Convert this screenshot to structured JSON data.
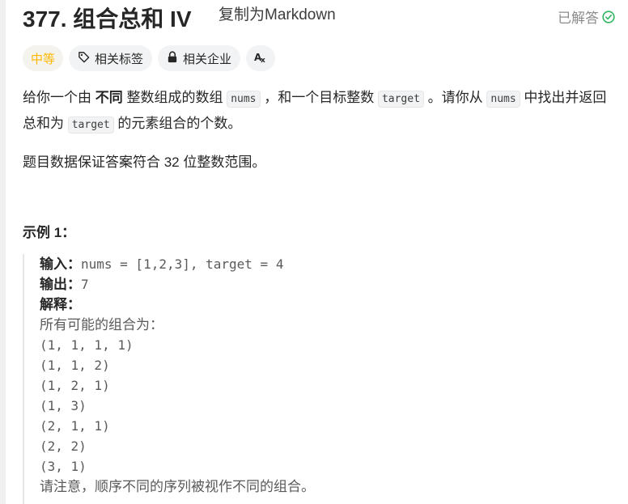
{
  "header": {
    "title": "377. 组合总和 IV",
    "copy_markdown": "复制为Markdown",
    "solved_label": "已解答"
  },
  "tags": {
    "difficulty": "中等",
    "related_tags": "相关标签",
    "related_companies": "相关企业",
    "translate_icon": "Aあ"
  },
  "description": {
    "p1": {
      "t1": "给你一个由 ",
      "bold": "不同",
      "t2": " 整数组成的数组 ",
      "code1": "nums",
      "t3": " ，和一个目标整数 ",
      "code2": "target",
      "t4": " 。请你从 ",
      "code3": "nums",
      "t5": " 中找出并返回总和为 ",
      "code4": "target",
      "t6": " 的元素组合的个数。"
    },
    "p2": "题目数据保证答案符合 32 位整数范围。"
  },
  "example": {
    "title": "示例 1：",
    "input_label": "输入：",
    "input_value": "nums = [1,2,3], target = 4",
    "output_label": "输出：",
    "output_value": "7",
    "explain_label": "解释：",
    "explain_lines": [
      "所有可能的组合为：",
      "(1, 1, 1, 1)",
      "(1, 1, 2)",
      "(1, 2, 1)",
      "(1, 3)",
      "(2, 1, 1)",
      "(2, 2)",
      "(3, 1)",
      "请注意，顺序不同的序列被视作不同的组合。"
    ]
  },
  "colors": {
    "difficulty": "#ffb800",
    "solved_check": "#2db55d",
    "tag_bg": "#f2f3f4"
  }
}
